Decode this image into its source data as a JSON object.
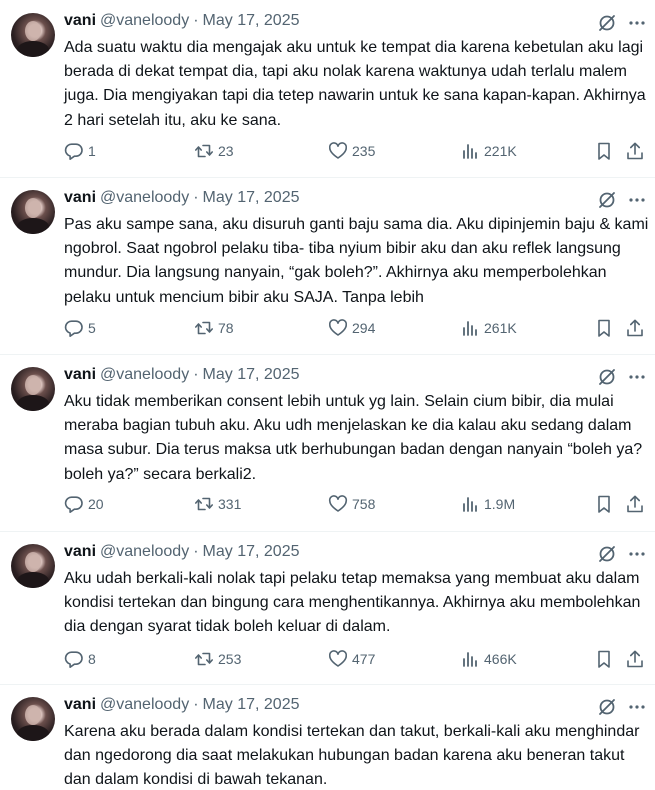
{
  "tweets": [
    {
      "name": "vani",
      "handle": "@vaneloody",
      "separator": "·",
      "date": "May 17, 2025",
      "text": "Ada suatu waktu dia mengajak aku untuk ke tempat dia karena kebetulan aku lagi berada di dekat tempat dia, tapi aku nolak karena waktunya udah terlalu malem juga. Dia mengiyakan tapi dia tetep nawarin untuk ke sana kapan-kapan. Akhirnya 2 hari setelah itu, aku ke sana.",
      "replies": "1",
      "reposts": "23",
      "likes": "235",
      "views": "221K"
    },
    {
      "name": "vani",
      "handle": "@vaneloody",
      "separator": "·",
      "date": "May 17, 2025",
      "text": "Pas aku sampe sana, aku disuruh ganti baju sama dia. Aku dipinjemin baju & kami ngobrol. Saat ngobrol pelaku tiba- tiba nyium bibir aku dan aku reflek langsung mundur. Dia langsung nanyain, “gak boleh?”. Akhirnya aku memperbolehkan pelaku untuk mencium bibir aku SAJA. Tanpa lebih",
      "replies": "5",
      "reposts": "78",
      "likes": "294",
      "views": "261K"
    },
    {
      "name": "vani",
      "handle": "@vaneloody",
      "separator": "·",
      "date": "May 17, 2025",
      "text": "Aku tidak memberikan consent lebih untuk yg lain. Selain cium bibir, dia mulai meraba bagian tubuh aku. Aku udh menjelaskan ke dia kalau aku sedang dalam masa subur. Dia terus maksa utk berhubungan badan dengan nanyain “boleh ya? boleh ya?” secara berkali2.",
      "replies": "20",
      "reposts": "331",
      "likes": "758",
      "views": "1.9M"
    },
    {
      "name": "vani",
      "handle": "@vaneloody",
      "separator": "·",
      "date": "May 17, 2025",
      "text": "Aku udah berkali-kali nolak tapi pelaku tetap memaksa yang membuat aku dalam kondisi tertekan dan bingung cara menghentikannya. Akhirnya aku membolehkan dia dengan syarat tidak boleh keluar di dalam.",
      "replies": "8",
      "reposts": "253",
      "likes": "477",
      "views": "466K"
    },
    {
      "name": "vani",
      "handle": "@vaneloody",
      "separator": "·",
      "date": "May 17, 2025",
      "text": "Karena aku berada dalam kondisi tertekan dan takut, berkali-kali aku menghindar dan ngedorong dia saat melakukan hubungan badan karena aku beneran takut dan dalam kondisi di bawah tekanan."
    }
  ],
  "icons": {
    "grok": "grok-icon",
    "more": "more-icon",
    "reply": "reply-icon",
    "repost": "repost-icon",
    "like": "like-icon",
    "views": "views-icon",
    "bookmark": "bookmark-icon",
    "share": "share-icon"
  },
  "colors": {
    "text": "#0f1419",
    "secondary": "#536471",
    "divider": "#eff3f4",
    "background": "#ffffff"
  }
}
